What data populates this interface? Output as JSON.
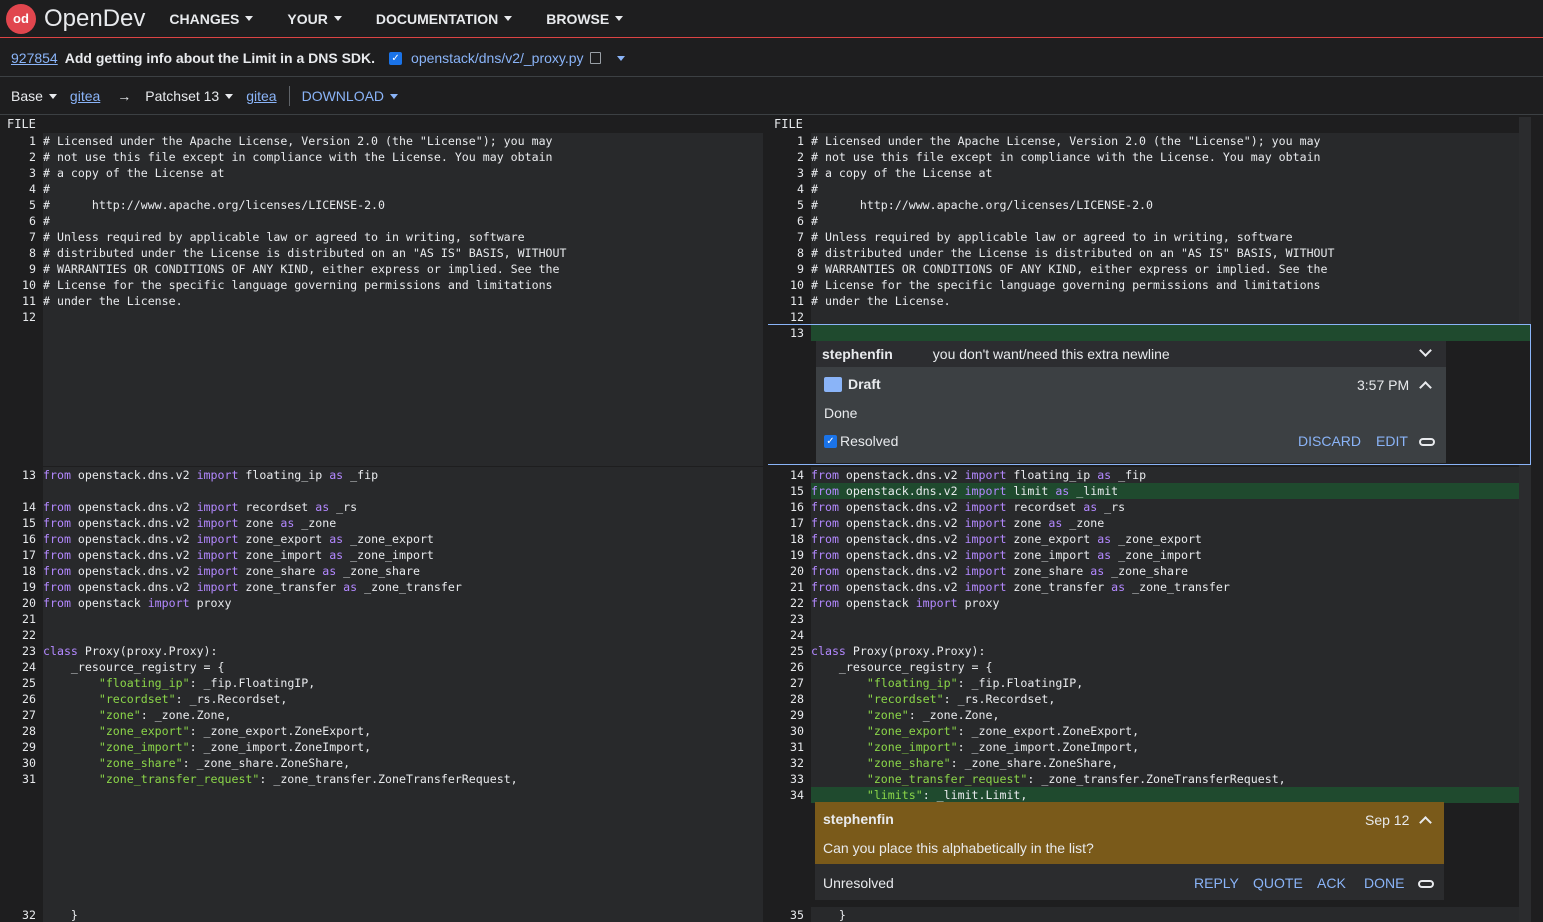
{
  "header": {
    "logo_mark": "od",
    "brand": "OpenDev",
    "nav": [
      "CHANGES",
      "YOUR",
      "DOCUMENTATION",
      "BROWSE"
    ]
  },
  "change": {
    "number": "927854",
    "subject": "Add getting info about the Limit in a DNS SDK.",
    "file": "openstack/dns/v2/_proxy.py"
  },
  "toolbar": {
    "base": "Base",
    "base_link": "gitea",
    "arrow": "→",
    "patchset": "Patchset 13",
    "patch_link": "gitea",
    "download": "DOWNLOAD"
  },
  "diff": {
    "file_label_left": "FILE",
    "file_label_right": "FILE",
    "left": [
      {
        "n": "1",
        "t": "# Licensed under the Apache License, Version 2.0 (the \"License\"); you may"
      },
      {
        "n": "2",
        "t": "# not use this file except in compliance with the License. You may obtain"
      },
      {
        "n": "3",
        "t": "# a copy of the License at"
      },
      {
        "n": "4",
        "t": "#"
      },
      {
        "n": "5",
        "t": "#      http://www.apache.org/licenses/LICENSE-2.0"
      },
      {
        "n": "6",
        "t": "#"
      },
      {
        "n": "7",
        "t": "# Unless required by applicable law or agreed to in writing, software"
      },
      {
        "n": "8",
        "t": "# distributed under the License is distributed on an \"AS IS\" BASIS, WITHOUT"
      },
      {
        "n": "9",
        "t": "# WARRANTIES OR CONDITIONS OF ANY KIND, either express or implied. See the"
      },
      {
        "n": "10",
        "t": "# License for the specific language governing permissions and limitations"
      },
      {
        "n": "11",
        "t": "# under the License."
      },
      {
        "n": "12",
        "t": ""
      }
    ],
    "right": [
      {
        "n": "1",
        "t": "# Licensed under the Apache License, Version 2.0 (the \"License\"); you may"
      },
      {
        "n": "2",
        "t": "# not use this file except in compliance with the License. You may obtain"
      },
      {
        "n": "3",
        "t": "# a copy of the License at"
      },
      {
        "n": "4",
        "t": "#"
      },
      {
        "n": "5",
        "t": "#      http://www.apache.org/licenses/LICENSE-2.0"
      },
      {
        "n": "6",
        "t": "#"
      },
      {
        "n": "7",
        "t": "# Unless required by applicable law or agreed to in writing, software"
      },
      {
        "n": "8",
        "t": "# distributed under the License is distributed on an \"AS IS\" BASIS, WITHOUT"
      },
      {
        "n": "9",
        "t": "# WARRANTIES OR CONDITIONS OF ANY KIND, either express or implied. See the"
      },
      {
        "n": "10",
        "t": "# License for the specific language governing permissions and limitations"
      },
      {
        "n": "11",
        "t": "# under the License."
      },
      {
        "n": "12",
        "t": ""
      },
      {
        "n": "13",
        "t": ""
      }
    ],
    "left_b": [
      {
        "n": "13",
        "from": "openstack.dns.v2",
        "import": "floating_ip",
        "as": "_fip"
      }
    ],
    "left_c": [
      {
        "n": "14",
        "from": "openstack.dns.v2",
        "import": "recordset",
        "as": "_rs"
      },
      {
        "n": "15",
        "from": "openstack.dns.v2",
        "import": "zone",
        "as": "_zone"
      },
      {
        "n": "16",
        "from": "openstack.dns.v2",
        "import": "zone_export",
        "as": "_zone_export"
      },
      {
        "n": "17",
        "from": "openstack.dns.v2",
        "import": "zone_import",
        "as": "_zone_import"
      },
      {
        "n": "18",
        "from": "openstack.dns.v2",
        "import": "zone_share",
        "as": "_zone_share"
      },
      {
        "n": "19",
        "from": "openstack.dns.v2",
        "import": "zone_transfer",
        "as": "_zone_transfer"
      },
      {
        "n": "20",
        "from": "openstack",
        "import": "proxy",
        "as": ""
      }
    ],
    "right_b": [
      {
        "n": "14",
        "from": "openstack.dns.v2",
        "import": "floating_ip",
        "as": "_fip"
      },
      {
        "n": "15",
        "from": "openstack.dns.v2",
        "import": "limit",
        "as": "_limit"
      },
      {
        "n": "16",
        "from": "openstack.dns.v2",
        "import": "recordset",
        "as": "_rs"
      },
      {
        "n": "17",
        "from": "openstack.dns.v2",
        "import": "zone",
        "as": "_zone"
      },
      {
        "n": "18",
        "from": "openstack.dns.v2",
        "import": "zone_export",
        "as": "_zone_export"
      },
      {
        "n": "19",
        "from": "openstack.dns.v2",
        "import": "zone_import",
        "as": "_zone_import"
      },
      {
        "n": "20",
        "from": "openstack.dns.v2",
        "import": "zone_share",
        "as": "_zone_share"
      },
      {
        "n": "21",
        "from": "openstack.dns.v2",
        "import": "zone_transfer",
        "as": "_zone_transfer"
      },
      {
        "n": "22",
        "from": "openstack",
        "import": "proxy",
        "as": ""
      }
    ],
    "left_d": [
      {
        "n": "21",
        "t": ""
      },
      {
        "n": "22",
        "t": ""
      },
      {
        "n": "23",
        "t": "class Proxy(proxy.Proxy):"
      },
      {
        "n": "24",
        "t": "    _resource_registry = {"
      },
      {
        "n": "25",
        "k": "\"floating_ip\"",
        "v": ": _fip.FloatingIP,"
      },
      {
        "n": "26",
        "k": "\"recordset\"",
        "v": ": _rs.Recordset,"
      },
      {
        "n": "27",
        "k": "\"zone\"",
        "v": ": _zone.Zone,"
      },
      {
        "n": "28",
        "k": "\"zone_export\"",
        "v": ": _zone_export.ZoneExport,"
      },
      {
        "n": "29",
        "k": "\"zone_import\"",
        "v": ": _zone_import.ZoneImport,"
      },
      {
        "n": "30",
        "k": "\"zone_share\"",
        "v": ": _zone_share.ZoneShare,"
      },
      {
        "n": "31",
        "k": "\"zone_transfer_request\"",
        "v": ": _zone_transfer.ZoneTransferRequest,"
      }
    ],
    "right_d": [
      {
        "n": "23",
        "t": ""
      },
      {
        "n": "24",
        "t": ""
      },
      {
        "n": "25",
        "t": "class Proxy(proxy.Proxy):"
      },
      {
        "n": "26",
        "t": "    _resource_registry = {"
      },
      {
        "n": "27",
        "k": "\"floating_ip\"",
        "v": ": _fip.FloatingIP,"
      },
      {
        "n": "28",
        "k": "\"recordset\"",
        "v": ": _rs.Recordset,"
      },
      {
        "n": "29",
        "k": "\"zone\"",
        "v": ": _zone.Zone,"
      },
      {
        "n": "30",
        "k": "\"zone_export\"",
        "v": ": _zone_export.ZoneExport,"
      },
      {
        "n": "31",
        "k": "\"zone_import\"",
        "v": ": _zone_import.ZoneImport,"
      },
      {
        "n": "32",
        "k": "\"zone_share\"",
        "v": ": _zone_share.ZoneShare,"
      },
      {
        "n": "33",
        "k": "\"zone_transfer_request\"",
        "v": ": _zone_transfer.ZoneTransferRequest,"
      },
      {
        "n": "34",
        "k": "\"limits\"",
        "v": ": _limit.Limit,"
      }
    ],
    "left_end": {
      "n": "32",
      "t": "    }"
    },
    "right_end": {
      "n": "35",
      "t": "    }"
    }
  },
  "thread1": {
    "author": "stephenfin",
    "summary": "you don't want/need this extra newline",
    "draft_label": "Draft",
    "time": "3:57 PM",
    "body": "Done",
    "resolved_label": "Resolved",
    "discard": "DISCARD",
    "edit": "EDIT"
  },
  "thread2": {
    "author": "stephenfin",
    "date": "Sep 12",
    "body": "Can you place this alphabetically in the list?",
    "status": "Unresolved",
    "reply": "REPLY",
    "quote": "QUOTE",
    "ack": "ACK",
    "done": "DONE"
  },
  "colors": {
    "accent": "#8ab4f8",
    "added_line": "#1f4a2e",
    "keyword": "#c678dd",
    "string": "#8bd649",
    "robot_card": "#7a5a1a",
    "brand": "#e1464e"
  }
}
